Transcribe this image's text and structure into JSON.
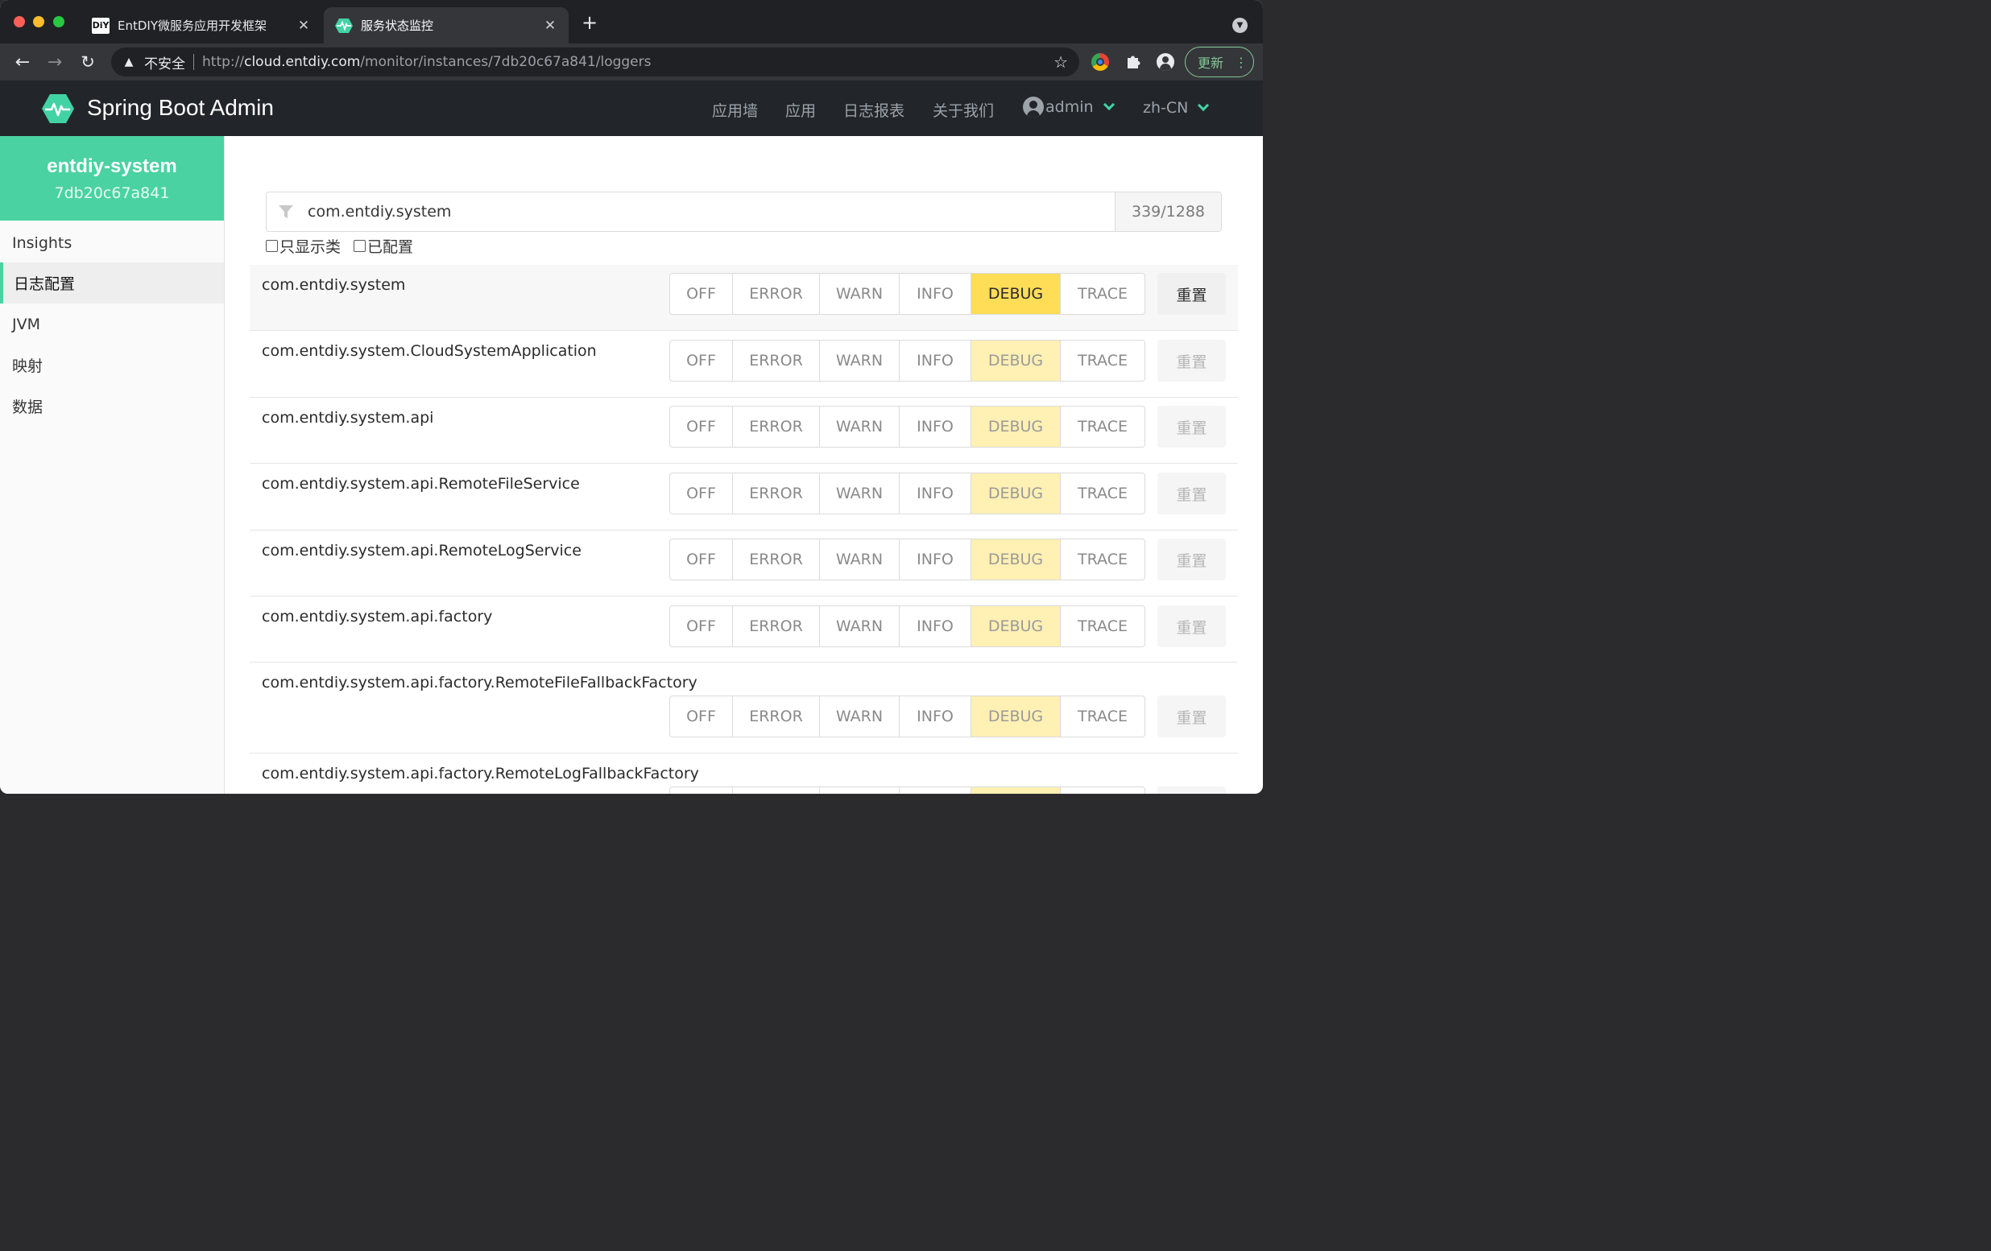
{
  "browser": {
    "tabs": [
      {
        "title": "EntDIY微服务应用开发框架",
        "favicon": "DiY",
        "active": false
      },
      {
        "title": "服务状态监控",
        "active": true
      }
    ],
    "insecure_label": "不安全",
    "url_scheme": "http://",
    "url_host": "cloud.entdiy.com",
    "url_path": "/monitor/instances/7db20c67a841/loggers",
    "update_label": "更新"
  },
  "app": {
    "brand": "Spring Boot Admin",
    "nav": [
      "应用墙",
      "应用",
      "日志报表",
      "关于我们"
    ],
    "user": "admin",
    "lang": "zh-CN",
    "accent_color": "#42d3a5"
  },
  "sidebar": {
    "instance_name": "entdiy-system",
    "instance_id": "7db20c67a841",
    "items": [
      {
        "label": "Insights",
        "active": false
      },
      {
        "label": "日志配置",
        "active": true
      },
      {
        "label": "JVM",
        "active": false
      },
      {
        "label": "映射",
        "active": false
      },
      {
        "label": "数据",
        "active": false
      }
    ]
  },
  "filter": {
    "value": "com.entdiy.system",
    "count": "339/1288",
    "only_classes_label": "只显示类",
    "configured_label": "已配置"
  },
  "levels": [
    "OFF",
    "ERROR",
    "WARN",
    "INFO",
    "DEBUG",
    "TRACE"
  ],
  "reset_label": "重置",
  "loggers": [
    {
      "name": "com.entdiy.system",
      "level": "DEBUG",
      "configured": true
    },
    {
      "name": "com.entdiy.system.CloudSystemApplication",
      "level": "DEBUG",
      "configured": false
    },
    {
      "name": "com.entdiy.system.api",
      "level": "DEBUG",
      "configured": false
    },
    {
      "name": "com.entdiy.system.api.RemoteFileService",
      "level": "DEBUG",
      "configured": false
    },
    {
      "name": "com.entdiy.system.api.RemoteLogService",
      "level": "DEBUG",
      "configured": false
    },
    {
      "name": "com.entdiy.system.api.factory",
      "level": "DEBUG",
      "configured": false
    },
    {
      "name": "com.entdiy.system.api.factory.RemoteFileFallbackFactory",
      "level": "DEBUG",
      "configured": false
    },
    {
      "name": "com.entdiy.system.api.factory.RemoteLogFallbackFactory",
      "level": "DEBUG",
      "configured": false
    }
  ]
}
